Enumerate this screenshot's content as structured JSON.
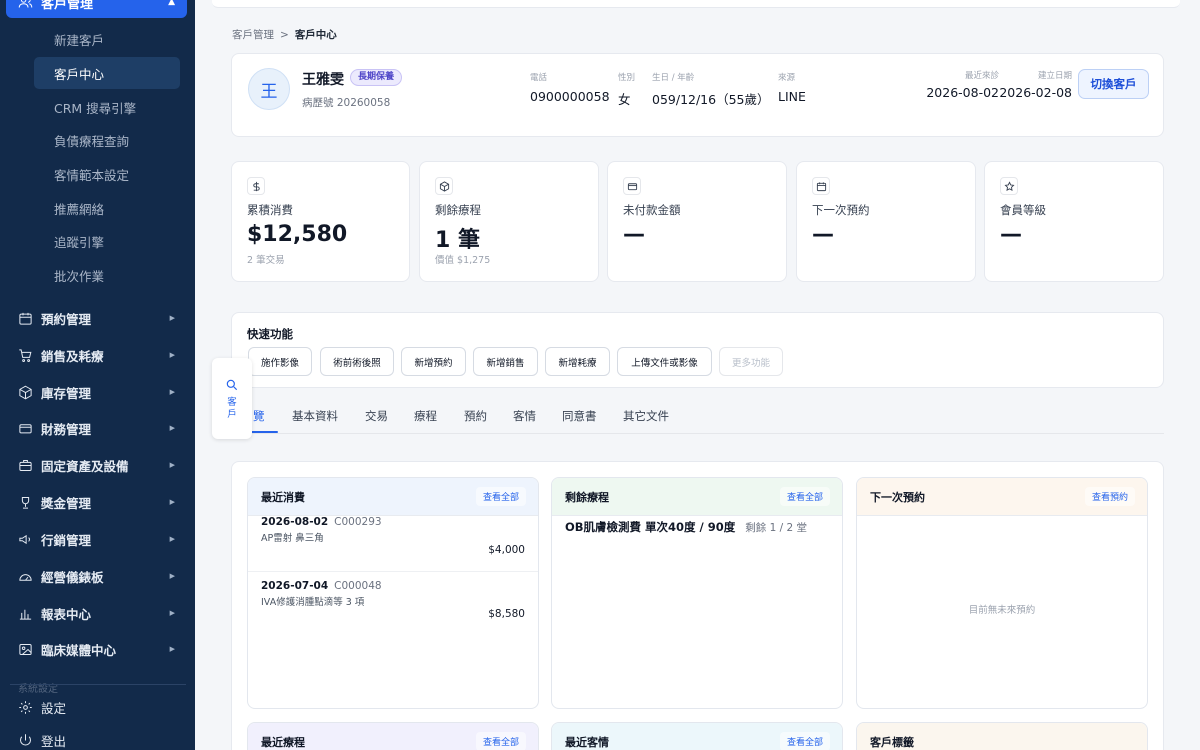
{
  "sidebar": {
    "active_parent": "客戶管理",
    "sub_items": [
      "新建客戶",
      "客戶中心",
      "CRM 搜尋引擎",
      "負債療程查詢",
      "客情範本設定",
      "推薦網絡",
      "追蹤引擎",
      "批次作業"
    ],
    "active_sub": "客戶中心",
    "nav_items": [
      {
        "label": "預約管理",
        "icon": "calendar-icon"
      },
      {
        "label": "銷售及耗療",
        "icon": "cart-icon"
      },
      {
        "label": "庫存管理",
        "icon": "box-icon"
      },
      {
        "label": "財務管理",
        "icon": "wallet-icon"
      },
      {
        "label": "固定資產及設備",
        "icon": "briefcase-icon"
      },
      {
        "label": "獎金管理",
        "icon": "trophy-icon"
      },
      {
        "label": "行銷管理",
        "icon": "megaphone-icon"
      },
      {
        "label": "經營儀錶板",
        "icon": "gauge-icon"
      },
      {
        "label": "報表中心",
        "icon": "bar-chart-icon"
      },
      {
        "label": "臨床媒體中心",
        "icon": "image-icon"
      }
    ],
    "faded_label": "系統設定",
    "settings": "設定",
    "logout": "登出"
  },
  "float_search": {
    "label": "客戶"
  },
  "breadcrumb": {
    "root": "客戶管理",
    "sep": ">",
    "current": "客戶中心"
  },
  "profile": {
    "avatar": "王",
    "name": "王雅雯",
    "badge": "長期保養",
    "record_no": "病歷號 20260058",
    "phone_label": "電話",
    "phone": "0900000058",
    "gender_label": "性別",
    "gender": "女",
    "birth_label": "生日 / 年齡",
    "birth": "059/12/16（55歲）",
    "source_label": "來源",
    "source": "LINE",
    "last_visit_label": "最近來診",
    "last_visit": "2026-08-02",
    "created_label": "建立日期",
    "created": "2026-02-08",
    "switch_button": "切換客戶"
  },
  "stats": [
    {
      "label": "累積消費",
      "value": "$12,580",
      "sub": "2 筆交易",
      "icon": "dollar-icon"
    },
    {
      "label": "剩餘療程",
      "value": "1 筆",
      "sub": "價值 $1,275",
      "icon": "cube-icon"
    },
    {
      "label": "未付款金額",
      "value": "—",
      "sub": "",
      "icon": "credit-card-icon"
    },
    {
      "label": "下一次預約",
      "value": "—",
      "sub": "",
      "icon": "calendar-icon"
    },
    {
      "label": "會員等級",
      "value": "—",
      "sub": "",
      "icon": "star-icon"
    }
  ],
  "quick": {
    "title": "快速功能",
    "buttons": [
      "施作影像",
      "術前術後照",
      "新增預約",
      "新增銷售",
      "新增耗療",
      "上傳文件或影像",
      "更多功能"
    ]
  },
  "tabs": [
    "總覽",
    "基本資料",
    "交易",
    "療程",
    "預約",
    "客情",
    "同意書",
    "其它文件"
  ],
  "tabs_visible_first": "覽",
  "panels": {
    "recent_spend": {
      "title": "最近消費",
      "action": "查看全部",
      "records": [
        {
          "date": "2026-08-02",
          "code": "C000293",
          "note": "AP雷射 鼻三角",
          "amount": "$4,000"
        },
        {
          "date": "2026-07-04",
          "code": "C000048",
          "note": "IVA修護消腫點滴等 3 項",
          "amount": "$8,580"
        }
      ]
    },
    "remaining": {
      "title": "剩餘療程",
      "action": "查看全部",
      "item": "OB肌膚檢測費 單次40度 / 90度",
      "remain": "剩餘 1 / 2 堂"
    },
    "next_appt": {
      "title": "下一次預約",
      "action": "查看預約",
      "empty": "目前無未來預約"
    },
    "recent_treatment": {
      "title": "最近療程",
      "action": "查看全部"
    },
    "recent_care": {
      "title": "最近客情",
      "action": "查看全部"
    },
    "tags": {
      "title": "客戶標籤"
    }
  },
  "colors": {
    "sidebar_bg": "#122a4a",
    "accent": "#2563eb",
    "spend_head": "#eef4fd",
    "remain_head": "#eef8f1",
    "appt_head": "#fdf6ee"
  }
}
